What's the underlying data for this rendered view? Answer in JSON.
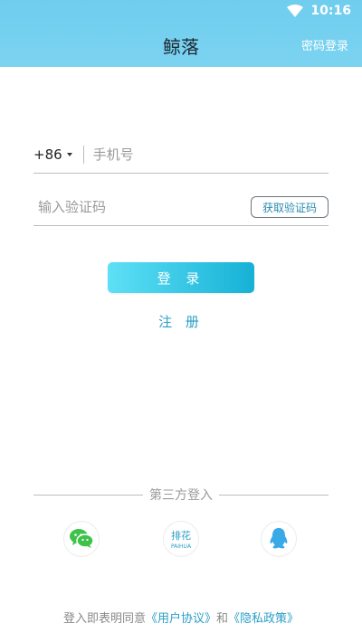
{
  "status_bar": {
    "time": "10:16"
  },
  "header": {
    "title": "鲸落",
    "password_login": "密码登录"
  },
  "phone": {
    "country_code": "+86",
    "placeholder": "手机号"
  },
  "verify": {
    "placeholder": "输入验证码",
    "get_code_label": "获取验证码"
  },
  "actions": {
    "login_label": "登 录",
    "register_label": "注 册"
  },
  "third_party": {
    "label": "第三方登入",
    "icons": [
      "wechat-icon",
      "paihua-icon",
      "qq-icon"
    ],
    "paihua_text_top": "排花",
    "paihua_text_bottom": "PAIHUA"
  },
  "agreement": {
    "prefix": "登入即表明同意",
    "user_agreement": "《用户协议》",
    "and": "和",
    "privacy_policy": "《隐私政策》"
  },
  "colors": {
    "header": "#7bd3f0",
    "accent": "#2a9ec6",
    "button_start": "#5ee0f6",
    "button_end": "#16b1d6"
  }
}
